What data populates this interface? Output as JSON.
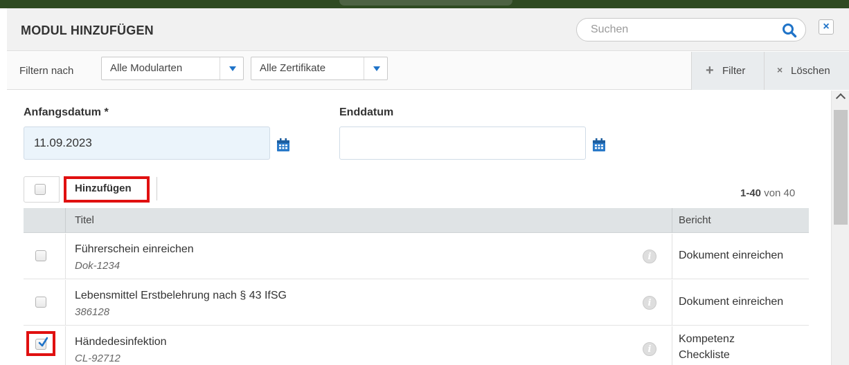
{
  "dialog": {
    "title": "MODUL HINZUFÜGEN",
    "search_placeholder": "Suchen",
    "close_symbol": "×"
  },
  "filterbar": {
    "label": "Filtern nach",
    "module_types_value": "Alle Modularten",
    "certificates_value": "Alle Zertifikate",
    "filter_symbol": "+",
    "filter_label": "Filter",
    "clear_symbol": "×",
    "clear_label": "Löschen"
  },
  "dates": {
    "start_label": "Anfangsdatum *",
    "start_value": "11.09.2023",
    "end_label": "Enddatum",
    "end_value": ""
  },
  "toolbar": {
    "add_label": "Hinzufügen",
    "paging_range": "1-40",
    "paging_suffix": " von 40"
  },
  "table": {
    "headers": [
      "Titel",
      "Bericht"
    ],
    "rows": [
      {
        "title": "Führerschein einreichen",
        "id": "Dok-1234",
        "report": "Dokument einreichen",
        "report2": "",
        "checked": false
      },
      {
        "title": "Lebensmittel Erstbelehrung nach § 43 IfSG",
        "id": "386128",
        "report": "Dokument einreichen",
        "report2": "",
        "checked": false
      },
      {
        "title": "Händedesinfektion",
        "id": "CL-92712",
        "report": "Kompetenz",
        "report2": "Checkliste",
        "checked": true
      }
    ],
    "info_symbol": "i"
  },
  "colors": {
    "accent_blue": "#1f73c8",
    "highlight_red": "#e01010",
    "header_bg": "#f1f1f1",
    "table_header_bg": "#dfe3e5"
  },
  "icons": [
    "search-icon",
    "close-icon",
    "dropdown-arrow-icon",
    "plus-icon",
    "x-icon",
    "calendar-icon",
    "info-icon",
    "checkmark-icon",
    "scroll-up-icon"
  ]
}
